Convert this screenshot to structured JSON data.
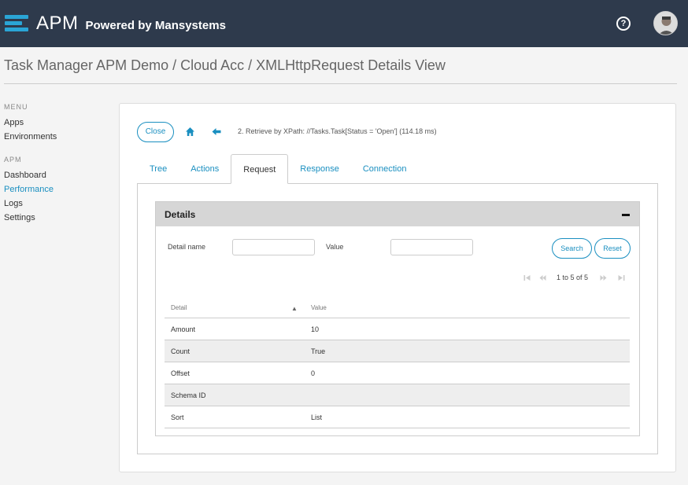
{
  "header": {
    "logo_text": "APM",
    "logo_subtitle": "Powered by Mansystems",
    "help_icon": "question-circle-icon",
    "help_symbol": "?",
    "brand_color": "#2aa5d6",
    "bar_color": "#2e3a4c"
  },
  "page": {
    "title": "Task Manager APM Demo / Cloud Acc / XMLHttpRequest Details View"
  },
  "sidebar": {
    "menu_heading": "MENU",
    "menu_items": [
      {
        "label": "Apps"
      },
      {
        "label": "Environments"
      }
    ],
    "apm_heading": "APM",
    "apm_items": [
      {
        "label": "Dashboard"
      },
      {
        "label": "Performance",
        "active": true
      },
      {
        "label": "Logs"
      },
      {
        "label": "Settings"
      }
    ]
  },
  "toolbar": {
    "close_label": "Close",
    "home_icon": "home-icon",
    "back_icon": "arrow-left-icon",
    "breadcrumb": "2. Retrieve by XPath: //Tasks.Task[Status = 'Open'] (114.18 ms)"
  },
  "tabs": [
    {
      "label": "Tree",
      "active": false
    },
    {
      "label": "Actions",
      "active": false
    },
    {
      "label": "Request",
      "active": true
    },
    {
      "label": "Response",
      "active": false
    },
    {
      "label": "Connection",
      "active": false
    }
  ],
  "details": {
    "title": "Details",
    "collapse_icon": "minus-icon",
    "filter": {
      "detail_name_label": "Detail name",
      "detail_name_value": "",
      "value_label": "Value",
      "value_value": "",
      "search_label": "Search",
      "reset_label": "Reset"
    },
    "pager": {
      "text": "1 to 5 of 5",
      "first_icon": "first-page-icon",
      "prev_icon": "prev-page-icon",
      "next_icon": "next-page-icon",
      "last_icon": "last-page-icon"
    },
    "table": {
      "columns": [
        "Detail",
        "Value"
      ],
      "sort_symbol": "▲",
      "rows": [
        {
          "detail": "Amount",
          "value": "10"
        },
        {
          "detail": "Count",
          "value": "True"
        },
        {
          "detail": "Offset",
          "value": "0"
        },
        {
          "detail": "Schema ID",
          "value": ""
        },
        {
          "detail": "Sort",
          "value": "List"
        }
      ]
    }
  }
}
